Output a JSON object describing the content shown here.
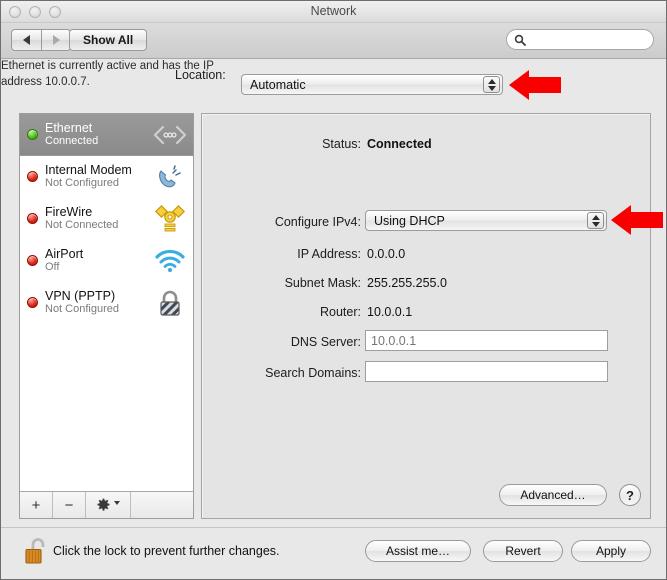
{
  "window": {
    "title": "Network",
    "traffic_lights": [
      "close",
      "minimize",
      "zoom"
    ]
  },
  "toolbar": {
    "back_label": "◀",
    "forward_label": "▶",
    "show_all_label": "Show All",
    "search": {
      "value": "",
      "placeholder": ""
    }
  },
  "location": {
    "label": "Location:",
    "selected": "Automatic",
    "options": [
      "Automatic"
    ]
  },
  "sidebar": {
    "services": [
      {
        "name": "Ethernet",
        "status": "Connected",
        "dot": "green",
        "icon": "ethernet-icon",
        "selected": true
      },
      {
        "name": "Internal Modem",
        "status": "Not Configured",
        "dot": "red",
        "icon": "modem-icon",
        "selected": false
      },
      {
        "name": "FireWire",
        "status": "Not Connected",
        "dot": "red",
        "icon": "firewire-icon",
        "selected": false
      },
      {
        "name": "AirPort",
        "status": "Off",
        "dot": "red",
        "icon": "airport-wifi-icon",
        "selected": false
      },
      {
        "name": "VPN (PPTP)",
        "status": "Not Configured",
        "dot": "red",
        "icon": "vpn-lock-icon",
        "selected": false
      }
    ],
    "toolbar": {
      "add_label": "+",
      "remove_label": "−",
      "action_label": "gear-icon"
    }
  },
  "main": {
    "status_label": "Status:",
    "status_value": "Connected",
    "status_description": "Ethernet is currently active and has the IP address 10.0.0.7.",
    "configure_ipv4_label": "Configure IPv4:",
    "configure_ipv4_value": "Using DHCP",
    "configure_ipv4_options": [
      "Using DHCP"
    ],
    "ip_address_label": "IP Address:",
    "ip_address_value": "0.0.0.0",
    "subnet_mask_label": "Subnet Mask:",
    "subnet_mask_value": "255.255.255.0",
    "router_label": "Router:",
    "router_value": "10.0.0.1",
    "dns_server_label": "DNS Server:",
    "dns_server_value": "",
    "dns_server_placeholder": "10.0.0.1",
    "search_domains_label": "Search Domains:",
    "search_domains_value": "",
    "search_domains_placeholder": "",
    "advanced_label": "Advanced…",
    "help_label": "?"
  },
  "bottom": {
    "lock_icon": "unlocked-padlock-icon",
    "lock_text": "Click the lock to prevent further changes.",
    "assist_label": "Assist me…",
    "revert_label": "Revert",
    "apply_label": "Apply"
  },
  "annotations": {
    "arrow_color": "#f80000",
    "arrows": [
      {
        "name": "location-popup-arrow",
        "points_to": "Location popup menu"
      },
      {
        "name": "configure-ipv4-popup-arrow",
        "points_to": "Configure IPv4 popup menu"
      }
    ]
  },
  "colors": {
    "connected_dot": "#4cc11c",
    "disconnected_dot": "#e02717",
    "selection": "#8f8f8f",
    "arrow_red": "#f80000"
  }
}
